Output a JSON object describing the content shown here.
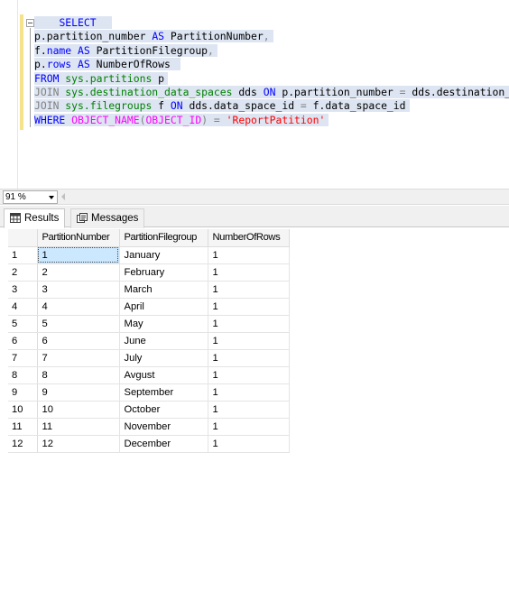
{
  "editor": {
    "lines": [
      {
        "segments": [
          {
            "t": "    ",
            "c": ""
          },
          {
            "t": "SELECT",
            "c": "kw"
          },
          {
            "t": "  ",
            "c": ""
          }
        ]
      },
      {
        "segments": [
          {
            "t": "p.partition_number ",
            "c": ""
          },
          {
            "t": "AS",
            "c": "kw"
          },
          {
            "t": " PartitionNumber",
            "c": ""
          },
          {
            "t": ",",
            "c": "gray"
          }
        ]
      },
      {
        "segments": [
          {
            "t": "f.",
            "c": ""
          },
          {
            "t": "name",
            "c": "kw"
          },
          {
            "t": " ",
            "c": ""
          },
          {
            "t": "AS",
            "c": "kw"
          },
          {
            "t": " PartitionFilegroup",
            "c": ""
          },
          {
            "t": ",",
            "c": "gray"
          }
        ]
      },
      {
        "segments": [
          {
            "t": "p.",
            "c": ""
          },
          {
            "t": "rows",
            "c": "kw"
          },
          {
            "t": " ",
            "c": ""
          },
          {
            "t": "AS",
            "c": "kw"
          },
          {
            "t": " NumberOfRows ",
            "c": ""
          }
        ]
      },
      {
        "segments": [
          {
            "t": "FROM",
            "c": "kw"
          },
          {
            "t": " ",
            "c": ""
          },
          {
            "t": "sys.partitions",
            "c": "sys"
          },
          {
            "t": " p",
            "c": ""
          }
        ]
      },
      {
        "segments": [
          {
            "t": "JOIN",
            "c": "gray"
          },
          {
            "t": " ",
            "c": ""
          },
          {
            "t": "sys.destination_data_spaces",
            "c": "sys"
          },
          {
            "t": " dds ",
            "c": ""
          },
          {
            "t": "ON",
            "c": "kw"
          },
          {
            "t": " p.partition_number ",
            "c": ""
          },
          {
            "t": "=",
            "c": "gray"
          },
          {
            "t": " dds.destination_id",
            "c": ""
          }
        ]
      },
      {
        "segments": [
          {
            "t": "JOIN",
            "c": "gray"
          },
          {
            "t": " ",
            "c": ""
          },
          {
            "t": "sys.filegroups",
            "c": "sys"
          },
          {
            "t": " f ",
            "c": ""
          },
          {
            "t": "ON",
            "c": "kw"
          },
          {
            "t": " dds.data_space_id ",
            "c": ""
          },
          {
            "t": "=",
            "c": "gray"
          },
          {
            "t": " f.data_space_id",
            "c": ""
          }
        ]
      },
      {
        "segments": [
          {
            "t": "WHERE",
            "c": "kw"
          },
          {
            "t": " ",
            "c": ""
          },
          {
            "t": "OBJECT_NAME",
            "c": "fn"
          },
          {
            "t": "(",
            "c": "gray"
          },
          {
            "t": "OBJECT_ID",
            "c": "fn"
          },
          {
            "t": ")",
            "c": "gray"
          },
          {
            "t": " ",
            "c": ""
          },
          {
            "t": "=",
            "c": "gray"
          },
          {
            "t": " ",
            "c": ""
          },
          {
            "t": "'ReportPatition'",
            "c": "str"
          }
        ]
      }
    ]
  },
  "zoom": {
    "value": "91 %"
  },
  "tabs": {
    "results_label": "Results",
    "messages_label": "Messages",
    "results_icon": "grid-icon",
    "messages_icon": "messages-icon"
  },
  "grid": {
    "columns": [
      "PartitionNumber",
      "PartitionFilegroup",
      "NumberOfRows"
    ],
    "rows": [
      {
        "n": "1",
        "cells": [
          "1",
          "January",
          "1"
        ]
      },
      {
        "n": "2",
        "cells": [
          "2",
          "February",
          "1"
        ]
      },
      {
        "n": "3",
        "cells": [
          "3",
          "March",
          "1"
        ]
      },
      {
        "n": "4",
        "cells": [
          "4",
          "April",
          "1"
        ]
      },
      {
        "n": "5",
        "cells": [
          "5",
          "May",
          "1"
        ]
      },
      {
        "n": "6",
        "cells": [
          "6",
          "June",
          "1"
        ]
      },
      {
        "n": "7",
        "cells": [
          "7",
          "July",
          "1"
        ]
      },
      {
        "n": "8",
        "cells": [
          "8",
          "Avgust",
          "1"
        ]
      },
      {
        "n": "9",
        "cells": [
          "9",
          "September",
          "1"
        ]
      },
      {
        "n": "10",
        "cells": [
          "10",
          "October",
          "1"
        ]
      },
      {
        "n": "11",
        "cells": [
          "11",
          "November",
          "1"
        ]
      },
      {
        "n": "12",
        "cells": [
          "12",
          "December",
          "1"
        ]
      }
    ],
    "selected_cell": {
      "row": 0,
      "col": 0
    }
  },
  "colors": {
    "keyword": "#0000ff",
    "system_object": "#008000",
    "operator": "#808080",
    "function": "#ff00ff",
    "string": "#ff0000",
    "selection": "#dde5f2",
    "selected_cell": "#cce8ff"
  }
}
